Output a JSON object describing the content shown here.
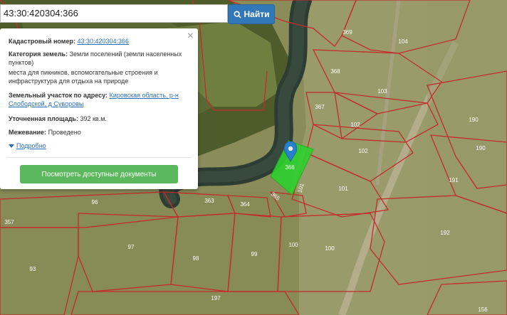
{
  "search": {
    "value": "43:30:420304:366",
    "button_label": "Найти",
    "button_icon": "search-icon"
  },
  "popup": {
    "cadastral_label": "Кадастровый номер:",
    "cadastral_value": "43:30:420304:366",
    "category_label": "Категория земель:",
    "category_value": "Земли поселений (земли населенных пунктов)",
    "usage_text": "места для пикников, вспомогательные строения и инфраструктура для отдыха на природе",
    "address_label": "Земельный участок по адресу:",
    "address_value": "Кировская область, р-н Слободской, д Суворовы",
    "area_label": "Уточненная площадь:",
    "area_value": "392 кв.м.",
    "survey_label": "Межевание:",
    "survey_value": "Проведено",
    "details_label": "Подробно",
    "docs_button": "Посмотреть доступные документы",
    "close_symbol": "×"
  },
  "map": {
    "selected_parcel_label": "366",
    "parcel_labels": [
      "369",
      "104",
      "368",
      "103",
      "367",
      "190",
      "102",
      "190",
      "102",
      "191",
      "101",
      "101",
      "365",
      "363",
      "364",
      "96",
      "357",
      "192",
      "97",
      "100",
      "100",
      "98",
      "99",
      "93",
      "197",
      "156"
    ],
    "colors": {
      "parcel_line": "#c42b2b",
      "selected_fill": "#2ed12e",
      "marker": "#2a81cb",
      "button_primary": "#3278b8",
      "button_success": "#5cb85c"
    }
  }
}
